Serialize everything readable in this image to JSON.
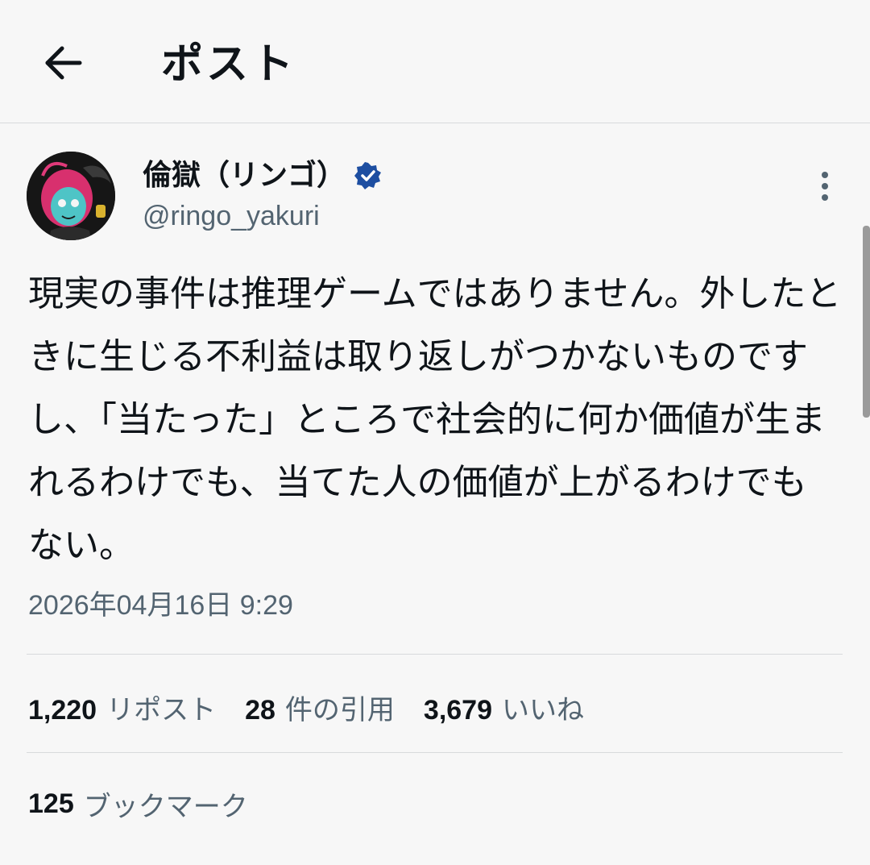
{
  "header": {
    "title": "ポスト",
    "back_icon": "arrow-left-icon"
  },
  "author": {
    "display_name": "倫獄（リンゴ）",
    "handle": "@ringo_yakuri",
    "verified_icon": "verified-badge-icon",
    "verified_color": "#1d4ea1",
    "more_icon": "more-vertical-icon"
  },
  "post": {
    "text": "現実の事件は推理ゲームではありません。外したときに生じる不利益は取り返しがつかないものですし、「当たった」ところで社会的に何か価値が生まれるわけでも、当てた人の価値が上がるわけでもない。",
    "timestamp": "2026年04月16日 9:29"
  },
  "stats": {
    "reposts_count": "1,220",
    "reposts_label": "リポスト",
    "quotes_count": "28",
    "quotes_label": "件の引用",
    "likes_count": "3,679",
    "likes_label": "いいね",
    "bookmarks_count": "125",
    "bookmarks_label": "ブックマーク"
  }
}
